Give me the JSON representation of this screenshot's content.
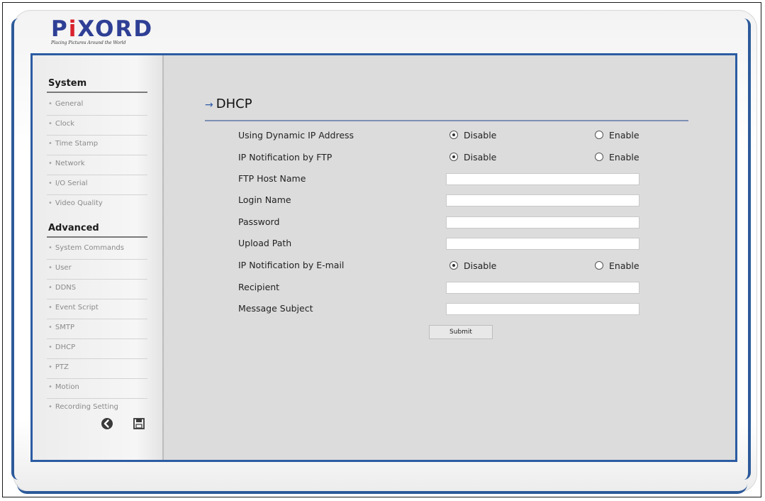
{
  "brand": {
    "logo": "PiXORD",
    "tagline": "Placing Pictures Around the World"
  },
  "sidebar": {
    "system_title": "System",
    "system_items": [
      "General",
      "Clock",
      "Time Stamp",
      "Network",
      "I/O Serial",
      "Video Quality"
    ],
    "advanced_title": "Advanced",
    "advanced_items": [
      "System Commands",
      "User",
      "DDNS",
      "Event Script",
      "SMTP",
      "DHCP",
      "PTZ",
      "Motion",
      "Recording Setting"
    ],
    "footer_icons": [
      "back-icon",
      "save-icon"
    ]
  },
  "main": {
    "title": "DHCP",
    "fields": {
      "dynamic_ip": {
        "label": "Using Dynamic IP Address",
        "disable": "Disable",
        "enable": "Enable",
        "selected": "Disable"
      },
      "ftp_notify": {
        "label": "IP Notification by FTP",
        "disable": "Disable",
        "enable": "Enable",
        "selected": "Disable"
      },
      "ftp_host": {
        "label": "FTP Host Name",
        "value": ""
      },
      "login_name": {
        "label": "Login Name",
        "value": ""
      },
      "password": {
        "label": "Password",
        "value": ""
      },
      "upload_path": {
        "label": "Upload Path",
        "value": ""
      },
      "email_notify": {
        "label": "IP Notification by E-mail",
        "disable": "Disable",
        "enable": "Enable",
        "selected": "Disable"
      },
      "recipient": {
        "label": "Recipient",
        "value": ""
      },
      "message_subject": {
        "label": "Message Subject",
        "value": ""
      }
    },
    "submit_label": "Submit"
  },
  "colors": {
    "accent_blue": "#2b5ca3",
    "logo_blue": "#2e3f95",
    "logo_red": "#d9232d",
    "content_bg": "#dcdcdc"
  }
}
